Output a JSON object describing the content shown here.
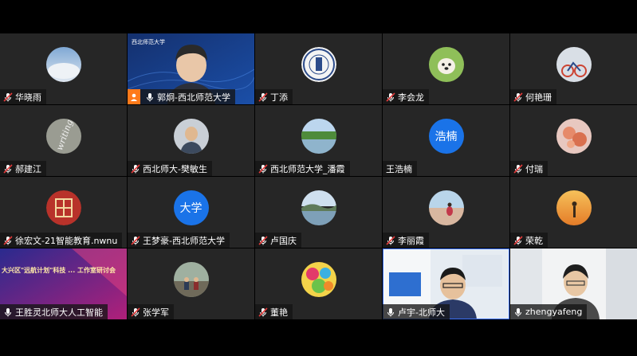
{
  "participants": [
    {
      "name": "华晓雨",
      "avatar": "sky-photo",
      "muted": true
    },
    {
      "name": "郭炯-西北师范大学",
      "avatar": "video-feed",
      "muted": false,
      "host": true,
      "badge": "西北师范大学"
    },
    {
      "name": "丁添",
      "avatar": "university-seal",
      "muted": true
    },
    {
      "name": "李会龙",
      "avatar": "dog-photo",
      "muted": true
    },
    {
      "name": "何艳珊",
      "avatar": "bicycle-photo",
      "muted": true
    },
    {
      "name": "郝建江",
      "avatar": "writing-text",
      "avatar_text": "writing",
      "muted": true
    },
    {
      "name": "西北师大-樊敏生",
      "avatar": "person-photo",
      "muted": true
    },
    {
      "name": "西北师范大学_潘霞",
      "avatar": "lake-photo",
      "muted": true
    },
    {
      "name": "王浩楠",
      "avatar": "text-avatar",
      "avatar_text": "浩楠",
      "muted": false,
      "no_icon": true
    },
    {
      "name": "付瑞",
      "avatar": "flower-photo",
      "muted": true
    },
    {
      "name": "徐宏文-21智能教育.nwnu",
      "avatar": "fu-character",
      "muted": true
    },
    {
      "name": "王梦豪-西北师范大学",
      "avatar": "text-avatar",
      "avatar_text": "大学",
      "muted": true
    },
    {
      "name": "卢国庆",
      "avatar": "landscape-photo",
      "muted": true
    },
    {
      "name": "李丽霞",
      "avatar": "beach-photo",
      "muted": true
    },
    {
      "name": "荣乾",
      "avatar": "sunset-photo",
      "muted": true
    },
    {
      "name": "王胜灵北师大人工智能",
      "avatar": "banner-video",
      "banner_text": "大兴区\"远航计划\"科技 ... 工作室研讨会",
      "muted": false
    },
    {
      "name": "张学军",
      "avatar": "group-photo",
      "muted": true
    },
    {
      "name": "董艳",
      "avatar": "balloon-photo",
      "muted": true
    },
    {
      "name": "卢宇-北师大",
      "avatar": "video-feed-room",
      "muted": false
    },
    {
      "name": "zhengyafeng",
      "avatar": "video-feed-office",
      "muted": false
    }
  ],
  "colors": {
    "background": "#000000",
    "tile": "#262626",
    "host_badge": "#ff7a1a",
    "text_avatar": "#1a73e8",
    "mic_muted": "#e23b3b"
  }
}
